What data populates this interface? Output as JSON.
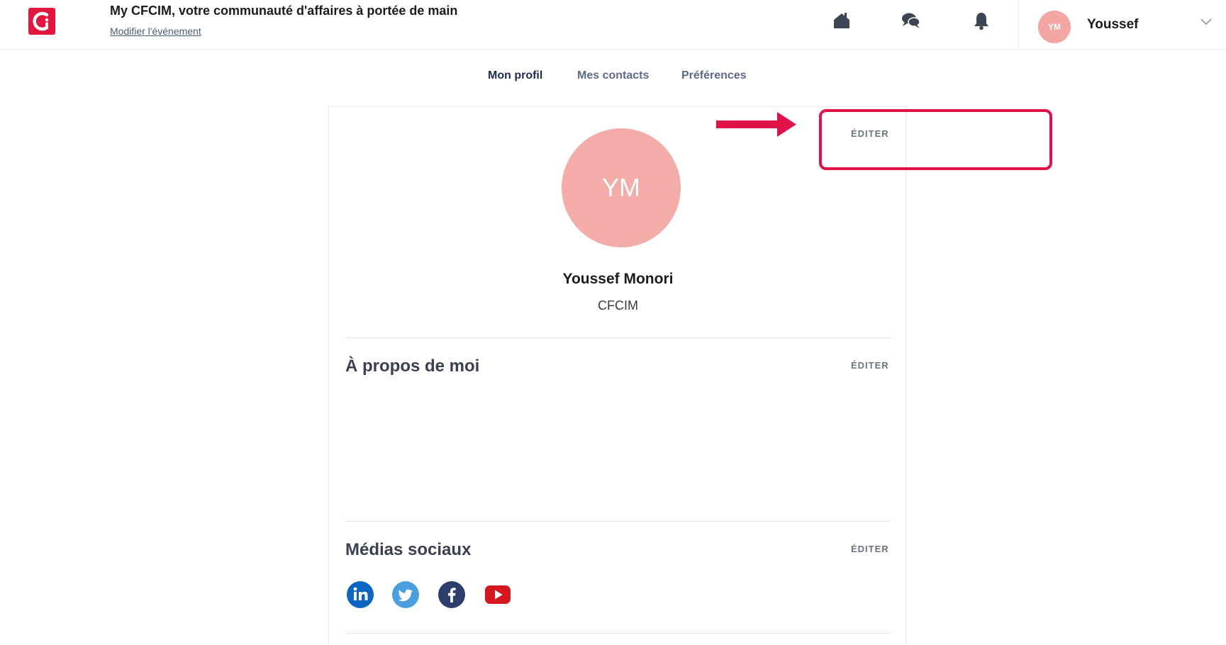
{
  "header": {
    "event_title": "My CFCIM, votre communauté d'affaires à portée de main",
    "event_link": "Modifier l'événement",
    "icons": [
      "home-icon",
      "chat-icon",
      "bell-icon"
    ],
    "user": {
      "initials": "YM",
      "name": "Youssef"
    }
  },
  "tabs": [
    {
      "label": "Mon profil",
      "active": true
    },
    {
      "label": "Mes contacts",
      "active": false
    },
    {
      "label": "Préférences",
      "active": false
    }
  ],
  "profile": {
    "initials": "YM",
    "full_name": "Youssef Monori",
    "company": "CFCIM",
    "edit_label": "ÉDITER"
  },
  "about": {
    "title": "À propos de moi",
    "edit_label": "ÉDITER"
  },
  "social_media": {
    "title": "Médias sociaux",
    "edit_label": "ÉDITER",
    "networks": [
      "linkedin-icon",
      "twitter-icon",
      "facebook-icon",
      "youtube-icon"
    ]
  },
  "colors": {
    "brand_red": "#e3173e",
    "avatar_pink": "#f3aca8",
    "annotation_red": "#e01247",
    "active_tab": "#1f2d4d",
    "tab": "#5b6a8c"
  }
}
